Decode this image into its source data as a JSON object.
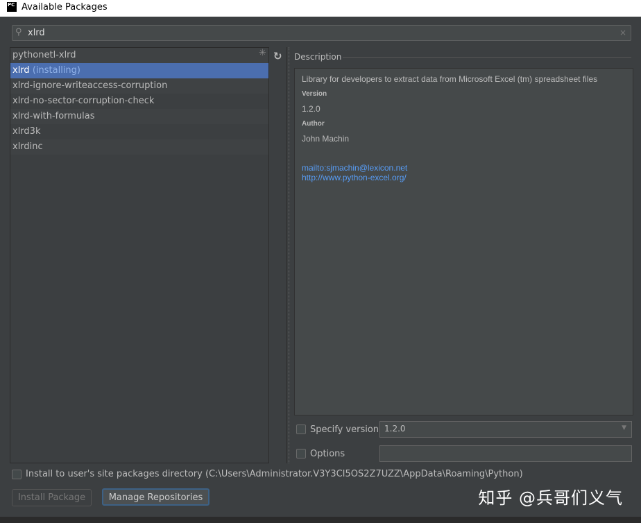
{
  "window": {
    "title": "Available Packages",
    "logo": "PC"
  },
  "search": {
    "value": "xlrd",
    "icon": "search-icon",
    "clear": "×"
  },
  "packages": [
    {
      "name": "pythonetl-xlrd",
      "status": ""
    },
    {
      "name": "xlrd",
      "status": "(installing)"
    },
    {
      "name": "xlrd-ignore-writeaccess-corruption",
      "status": ""
    },
    {
      "name": "xlrd-no-sector-corruption-check",
      "status": ""
    },
    {
      "name": "xlrd-with-formulas",
      "status": ""
    },
    {
      "name": "xlrd3k",
      "status": ""
    },
    {
      "name": "xlrdinc",
      "status": ""
    }
  ],
  "description": {
    "label": "Description",
    "summary": "Library for developers to extract data from Microsoft Excel (tm) spreadsheet files",
    "version_label": "Version",
    "version": "1.2.0",
    "author_label": "Author",
    "author": "John Machin",
    "links": [
      "mailto:sjmachin@lexicon.net",
      "http://www.python-excel.org/"
    ]
  },
  "options": {
    "specify_version_label": "Specify version",
    "specify_version_value": "1.2.0",
    "options_label": "Options",
    "options_value": ""
  },
  "install_user": {
    "label": "Install to user's site packages directory (C:\\Users\\Administrator.V3Y3CI5OS2Z7UZZ\\AppData\\Roaming\\Python)"
  },
  "buttons": {
    "install": "Install Package",
    "manage": "Manage Repositories"
  },
  "watermark": "知乎 @兵哥们义气"
}
